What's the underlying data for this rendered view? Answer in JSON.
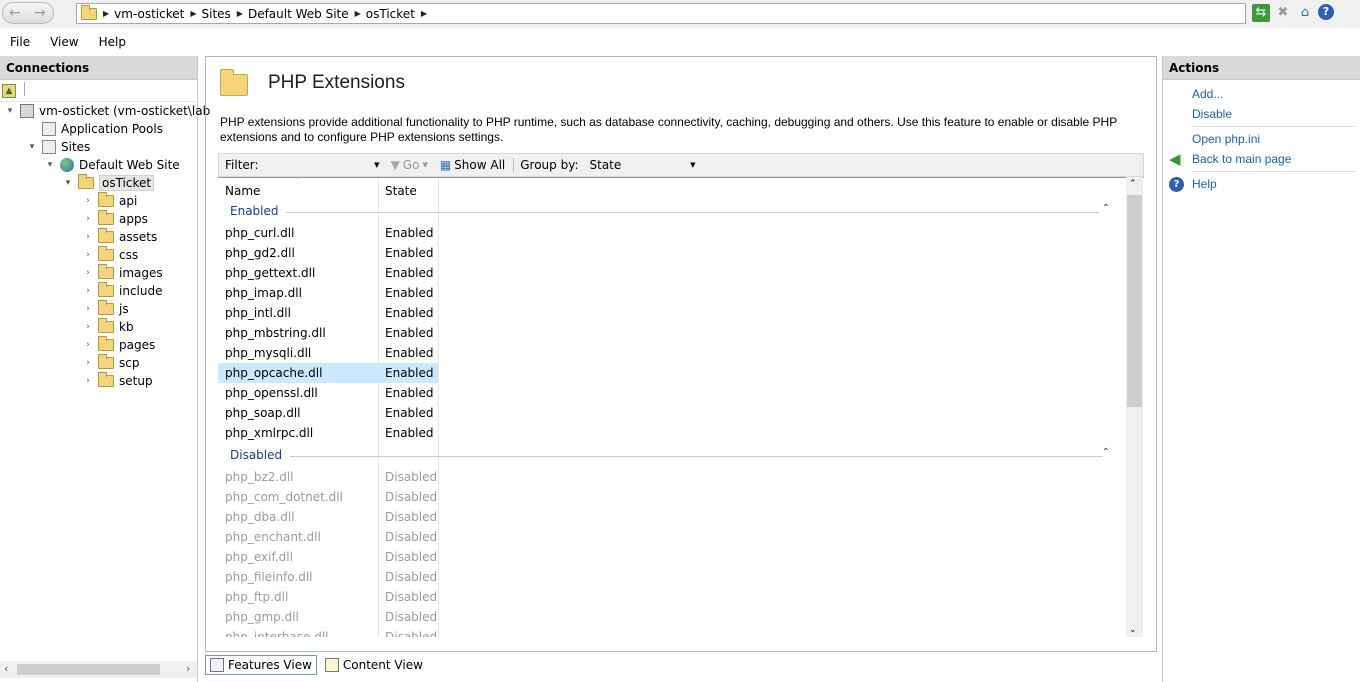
{
  "address_bar": {
    "crumbs": [
      "vm-osticket",
      "Sites",
      "Default Web Site",
      "osTicket"
    ]
  },
  "menu": [
    "File",
    "View",
    "Help"
  ],
  "connections": {
    "title": "Connections",
    "tree": [
      {
        "label": "vm-osticket (vm-osticket\\lab",
        "toggle": "▾",
        "icon": "server-icon"
      },
      {
        "label": "Application Pools",
        "toggle": "",
        "icon": "app-pools-icon"
      },
      {
        "label": "Sites",
        "toggle": "▾",
        "icon": "sites-icon"
      },
      {
        "label": "Default Web Site",
        "toggle": "▾",
        "icon": "globe-icon"
      },
      {
        "label": "osTicket",
        "toggle": "▾",
        "icon": "folder-icon",
        "selected": true
      },
      {
        "label": "api",
        "toggle": "›",
        "icon": "folder-icon"
      },
      {
        "label": "apps",
        "toggle": "›",
        "icon": "folder-icon"
      },
      {
        "label": "assets",
        "toggle": "›",
        "icon": "folder-icon"
      },
      {
        "label": "css",
        "toggle": "›",
        "icon": "folder-icon"
      },
      {
        "label": "images",
        "toggle": "›",
        "icon": "folder-icon"
      },
      {
        "label": "include",
        "toggle": "›",
        "icon": "folder-icon"
      },
      {
        "label": "js",
        "toggle": "›",
        "icon": "folder-icon"
      },
      {
        "label": "kb",
        "toggle": "›",
        "icon": "folder-icon"
      },
      {
        "label": "pages",
        "toggle": "›",
        "icon": "folder-icon"
      },
      {
        "label": "scp",
        "toggle": "›",
        "icon": "folder-icon"
      },
      {
        "label": "setup",
        "toggle": "›",
        "icon": "folder-icon"
      }
    ]
  },
  "feature": {
    "title": "PHP Extensions",
    "description": "PHP extensions provide additional functionality to PHP runtime, such as database connectivity, caching, debugging and others. Use this feature to enable or disable PHP extensions and to configure PHP extensions settings.",
    "filter_label": "Filter:",
    "filter_value": "",
    "go_label": "Go",
    "show_all_label": "Show All",
    "group_by_label": "Group by:",
    "group_by_value": "State",
    "columns": {
      "name": "Name",
      "state": "State"
    },
    "groups": [
      {
        "name": "Enabled",
        "rows": [
          {
            "name": "php_curl.dll",
            "state": "Enabled"
          },
          {
            "name": "php_gd2.dll",
            "state": "Enabled"
          },
          {
            "name": "php_gettext.dll",
            "state": "Enabled"
          },
          {
            "name": "php_imap.dll",
            "state": "Enabled"
          },
          {
            "name": "php_intl.dll",
            "state": "Enabled"
          },
          {
            "name": "php_mbstring.dll",
            "state": "Enabled"
          },
          {
            "name": "php_mysqli.dll",
            "state": "Enabled"
          },
          {
            "name": "php_opcache.dll",
            "state": "Enabled",
            "selected": true
          },
          {
            "name": "php_openssl.dll",
            "state": "Enabled"
          },
          {
            "name": "php_soap.dll",
            "state": "Enabled"
          },
          {
            "name": "php_xmlrpc.dll",
            "state": "Enabled"
          }
        ]
      },
      {
        "name": "Disabled",
        "rows": [
          {
            "name": "php_bz2.dll",
            "state": "Disabled"
          },
          {
            "name": "php_com_dotnet.dll",
            "state": "Disabled"
          },
          {
            "name": "php_dba.dll",
            "state": "Disabled"
          },
          {
            "name": "php_enchant.dll",
            "state": "Disabled"
          },
          {
            "name": "php_exif.dll",
            "state": "Disabled"
          },
          {
            "name": "php_fileinfo.dll",
            "state": "Disabled"
          },
          {
            "name": "php_ftp.dll",
            "state": "Disabled"
          },
          {
            "name": "php_gmp.dll",
            "state": "Disabled"
          },
          {
            "name": "php_interbase.dll",
            "state": "Disabled"
          }
        ]
      }
    ]
  },
  "view_tabs": {
    "features": "Features View",
    "content": "Content View"
  },
  "actions": {
    "title": "Actions",
    "add": "Add...",
    "disable": "Disable",
    "open_php_ini": "Open php.ini",
    "back": "Back to main page",
    "help": "Help"
  }
}
